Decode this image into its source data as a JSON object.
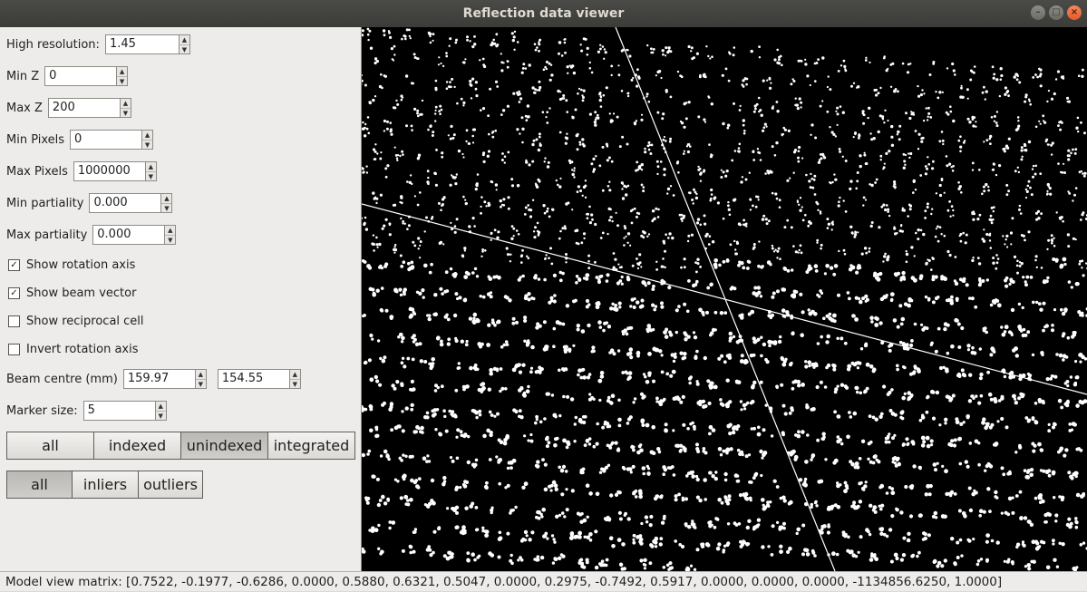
{
  "window": {
    "title": "Reflection data viewer"
  },
  "controls": {
    "high_resolution": {
      "label": "High resolution:",
      "value": "1.45"
    },
    "min_z": {
      "label": "Min Z",
      "value": "0"
    },
    "max_z": {
      "label": "Max Z",
      "value": "200"
    },
    "min_pixels": {
      "label": "Min Pixels",
      "value": "0"
    },
    "max_pixels": {
      "label": "Max Pixels",
      "value": "1000000"
    },
    "min_partiality": {
      "label": "Min partiality",
      "value": "0.000"
    },
    "max_partiality": {
      "label": "Max partiality",
      "value": "0.000"
    },
    "show_rotation_axis": {
      "label": "Show rotation axis",
      "checked": true
    },
    "show_beam_vector": {
      "label": "Show beam vector",
      "checked": true
    },
    "show_reciprocal_cell": {
      "label": "Show reciprocal cell",
      "checked": false
    },
    "invert_rotation_axis": {
      "label": "Invert rotation axis",
      "checked": false
    },
    "beam_centre": {
      "label": "Beam centre (mm)",
      "x": "159.97",
      "y": "154.55"
    },
    "marker_size": {
      "label": "Marker size:",
      "value": "5"
    }
  },
  "filter_buttons": {
    "labels": [
      "all",
      "indexed",
      "unindexed",
      "integrated"
    ],
    "active": "unindexed"
  },
  "outlier_buttons": {
    "labels": [
      "all",
      "inliers",
      "outliers"
    ],
    "active": "all"
  },
  "status": {
    "model_view_matrix": "Model view matrix: [0.7522, -0.1977, -0.6286, 0.0000, 0.5880, 0.6321, 0.5047, 0.0000, 0.2975, -0.7492, 0.5917, 0.0000, 0.0000, 0.0000, -1134856.6250, 1.0000]"
  },
  "viewer": {
    "background": "#000000",
    "spot_color": "#ffffff"
  }
}
